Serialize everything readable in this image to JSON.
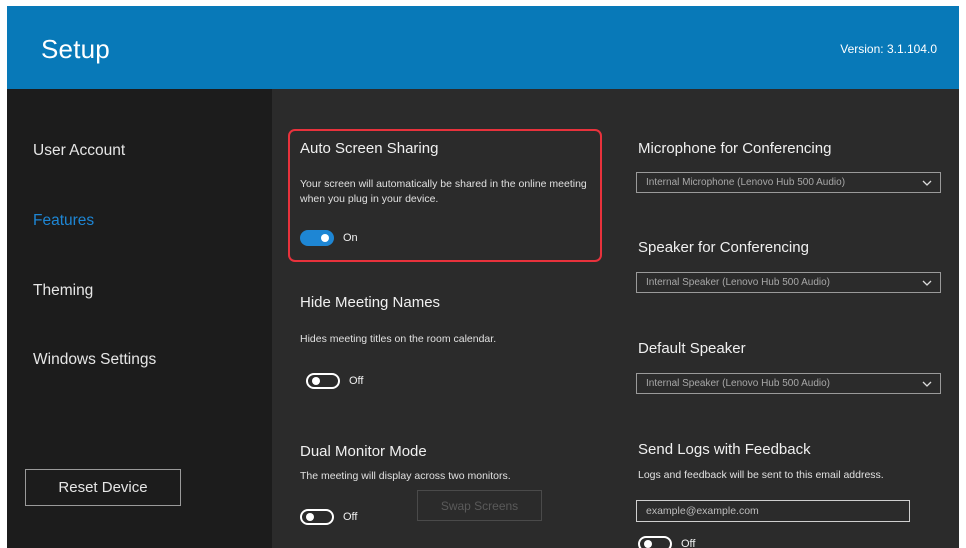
{
  "header": {
    "title": "Setup",
    "version": "Version: 3.1.104.0"
  },
  "sidebar": {
    "items": [
      {
        "label": "User Account"
      },
      {
        "label": "Features"
      },
      {
        "label": "Theming"
      },
      {
        "label": "Windows Settings"
      }
    ],
    "active_item": "Features",
    "reset_button": "Reset Device"
  },
  "features": {
    "auto_screen_sharing": {
      "title": "Auto Screen Sharing",
      "description_line1": "Your screen will automatically be shared in the online meeting",
      "description_line2": "when you plug in your device.",
      "toggle_state": "On",
      "enabled": true
    },
    "hide_meeting_names": {
      "title": "Hide Meeting Names",
      "description": "Hides meeting titles on the room calendar.",
      "toggle_state": "Off",
      "enabled": false
    },
    "dual_monitor_mode": {
      "title": "Dual Monitor Mode",
      "description": "The meeting will display across two monitors.",
      "toggle_state": "Off",
      "enabled": false,
      "swap_button": "Swap Screens"
    },
    "microphone": {
      "title": "Microphone for Conferencing",
      "selected": "Internal Microphone (Lenovo Hub 500 Audio)"
    },
    "speaker": {
      "title": "Speaker for Conferencing",
      "selected": "Internal Speaker (Lenovo Hub 500 Audio)"
    },
    "default_speaker": {
      "title": "Default Speaker",
      "selected": "Internal Speaker (Lenovo Hub 500 Audio)"
    },
    "send_logs": {
      "title": "Send Logs with Feedback",
      "description": "Logs and feedback will be sent to this email address.",
      "email_placeholder": "example@example.com",
      "toggle_state": "Off",
      "enabled": false
    }
  },
  "colors": {
    "header": "#0879b8",
    "sidebar": "#1c1c1c",
    "content": "#2b2b2b",
    "accent": "#1e86d4",
    "highlight": "#e8323c"
  }
}
